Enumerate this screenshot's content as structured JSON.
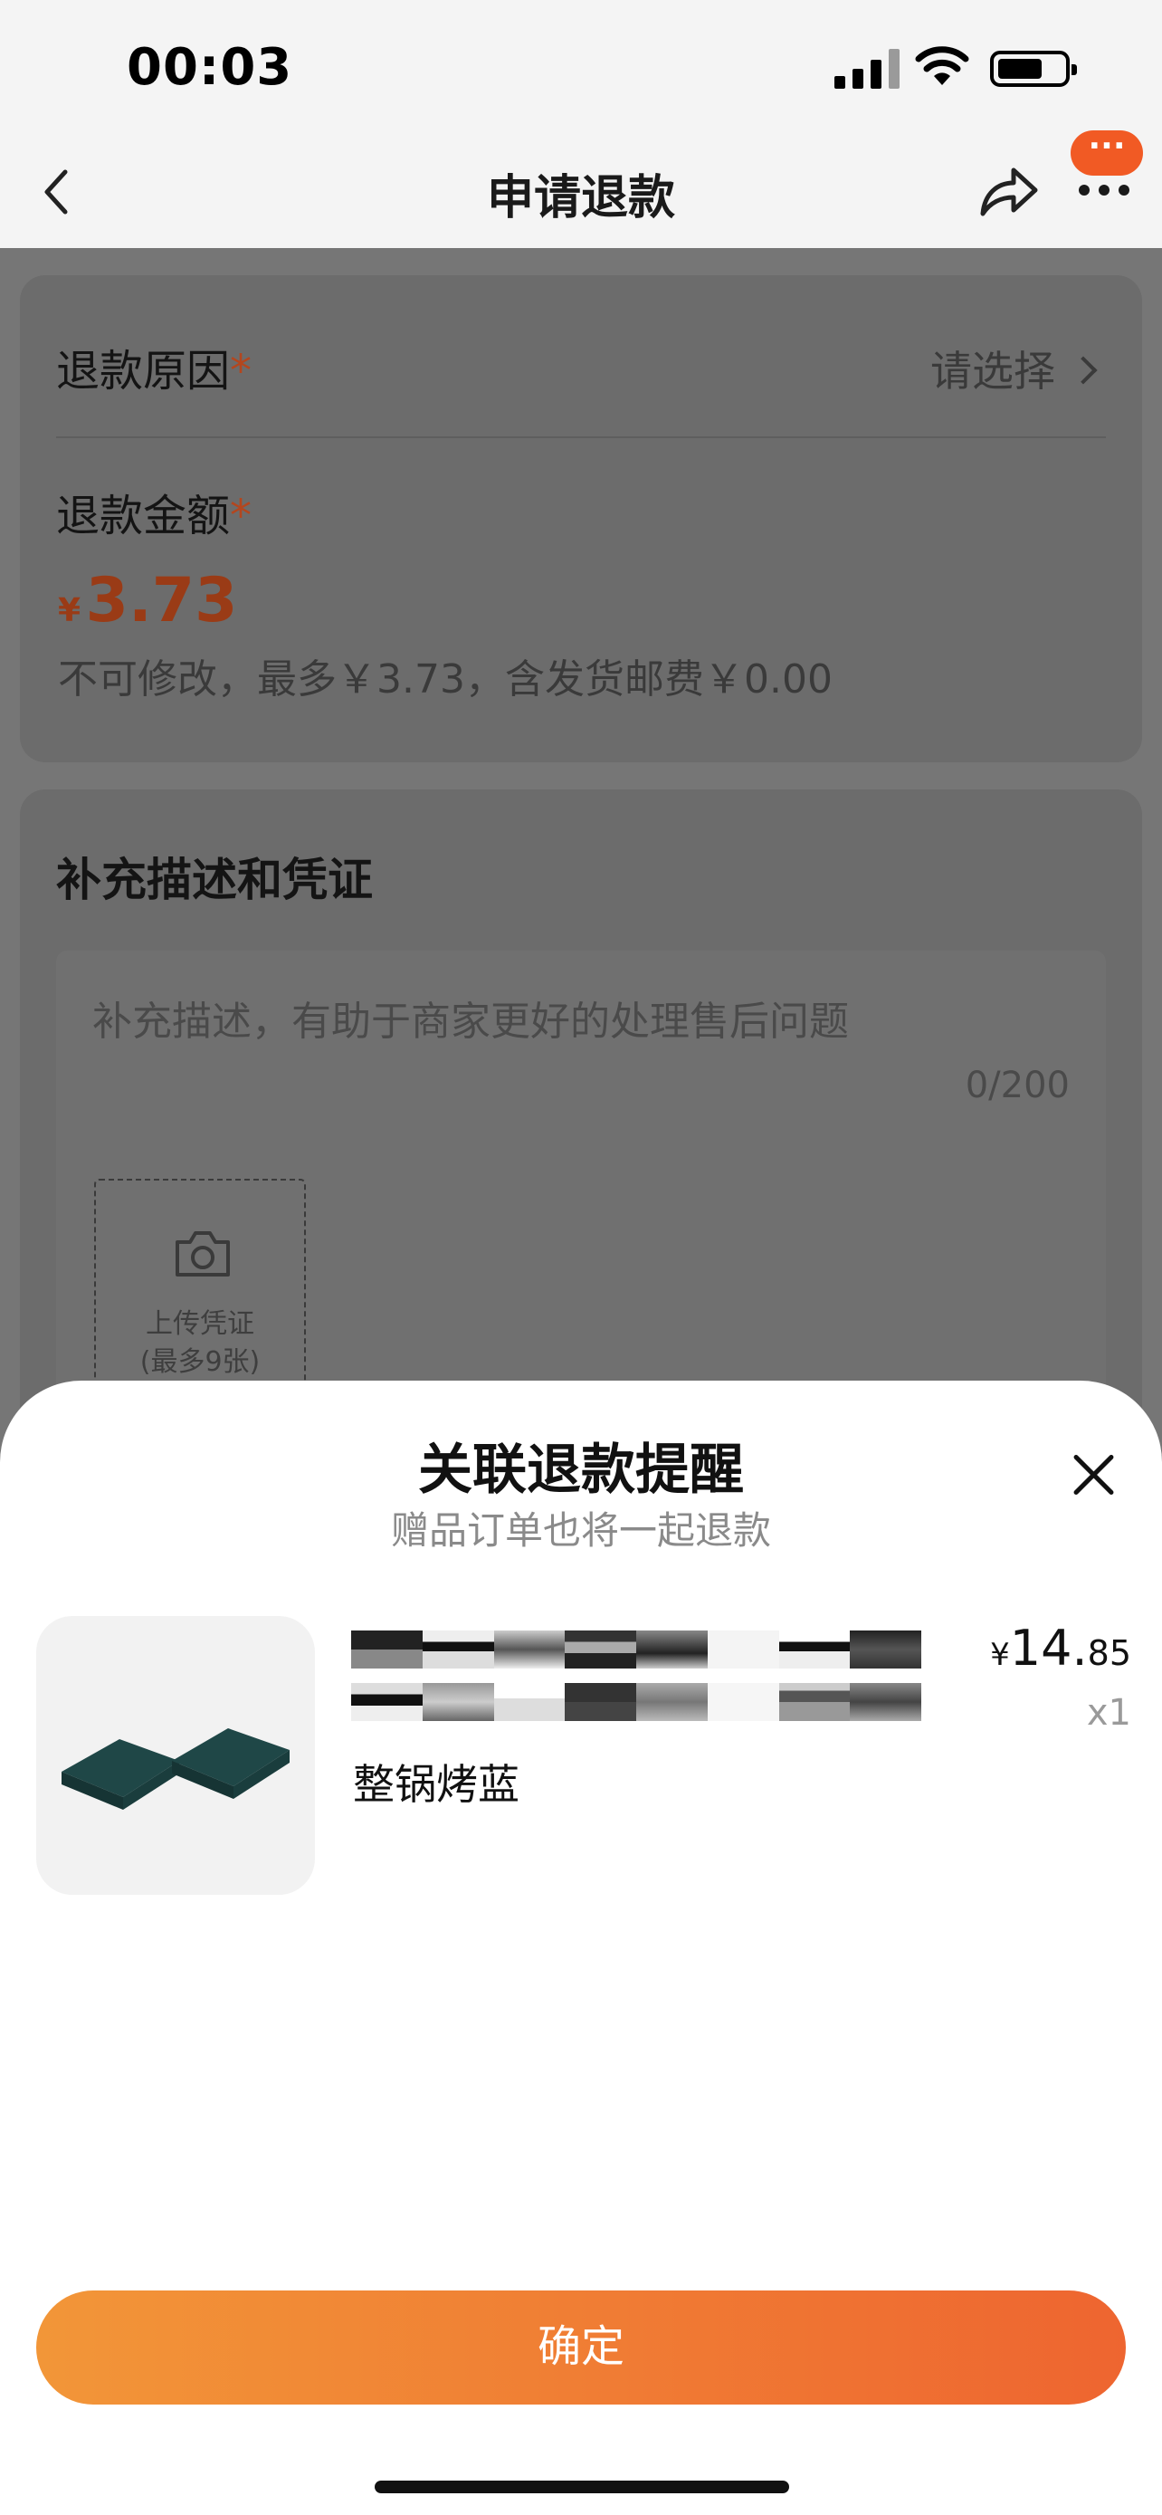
{
  "status_bar": {
    "time": "00:03"
  },
  "nav": {
    "title": "申请退款",
    "more_badge": "···"
  },
  "refund_form": {
    "reason_label": "退款原因",
    "required_mark": "*",
    "reason_placeholder": "请选择",
    "amount_label": "退款金额",
    "amount_currency": "¥",
    "amount_value": "3.73",
    "amount_note": "不可修改，最多￥3.73，含发货邮费￥0.00"
  },
  "supplement": {
    "title": "补充描述和凭证",
    "placeholder": "补充描述，有助于商家更好的处理售后问题",
    "counter": "0/200",
    "upload_label_line1": "上传凭证",
    "upload_label_line2": "(最多9张)"
  },
  "sheet": {
    "title": "关联退款提醒",
    "subtitle": "赠品订单也将一起退款",
    "product": {
      "name": "整锅烤蓝",
      "price_currency": "¥",
      "price_int": "14.",
      "price_dec": "85",
      "quantity": "x1"
    },
    "confirm_label": "确定"
  },
  "colors": {
    "accent_orange": "#f15a24",
    "button_gradient_start": "#f29638",
    "button_gradient_end": "#ee6530",
    "amount_red": "#9a3b16"
  },
  "icons": [
    "back-icon",
    "share-icon",
    "more-icon",
    "chevron-right-icon",
    "camera-icon",
    "close-icon"
  ]
}
